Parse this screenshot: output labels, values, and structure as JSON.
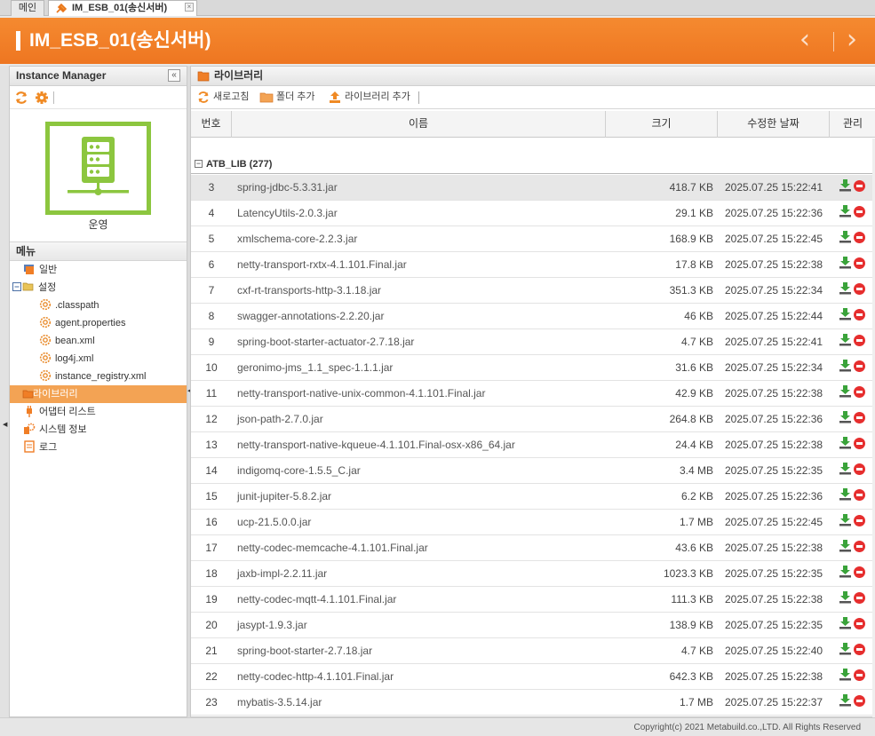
{
  "tabs": [
    {
      "label": "메인",
      "active": false
    },
    {
      "label": "IM_ESB_01(송신서버)",
      "active": true
    }
  ],
  "header": {
    "title": "IM_ESB_01(송신서버)",
    "prev_icon": "chevron-left-icon",
    "next_icon": "chevron-right-icon",
    "color": "#f07e26"
  },
  "left_panel": {
    "title": "Instance Manager",
    "server_label": "운영",
    "server_color": "#8cc63f",
    "menu_title": "메뉴",
    "tree": [
      {
        "label": "일반",
        "icon": "monitor-icon"
      },
      {
        "label": "설정",
        "icon": "folder-open-icon"
      },
      {
        "label": ".classpath",
        "icon": "gear-icon"
      },
      {
        "label": "agent.properties",
        "icon": "gear-icon"
      },
      {
        "label": "bean.xml",
        "icon": "gear-icon"
      },
      {
        "label": "log4j.xml",
        "icon": "gear-icon"
      },
      {
        "label": "instance_registry.xml",
        "icon": "gear-icon"
      },
      {
        "label": "라이브러리",
        "icon": "folder-icon",
        "selected": true
      },
      {
        "label": "어댑터 리스트",
        "icon": "plug-icon"
      },
      {
        "label": "시스템 정보",
        "icon": "system-info-icon"
      },
      {
        "label": "로그",
        "icon": "log-icon"
      }
    ]
  },
  "right_panel": {
    "title": "라이브러리",
    "toolbar": {
      "refresh": "새로고침",
      "add_folder": "폴더 추가",
      "add_library": "라이브러리 추가"
    },
    "columns": {
      "no": "번호",
      "name": "이름",
      "size": "크기",
      "date": "수정한 날짜",
      "manage": "관리"
    },
    "group": "ATB_LIB (277)",
    "rows": [
      {
        "no": "3",
        "name": "spring-jdbc-5.3.31.jar",
        "size": "418.7 KB",
        "date": "2025.07.25 15:22:41"
      },
      {
        "no": "4",
        "name": "LatencyUtils-2.0.3.jar",
        "size": "29.1 KB",
        "date": "2025.07.25 15:22:36"
      },
      {
        "no": "5",
        "name": "xmlschema-core-2.2.3.jar",
        "size": "168.9 KB",
        "date": "2025.07.25 15:22:45"
      },
      {
        "no": "6",
        "name": "netty-transport-rxtx-4.1.101.Final.jar",
        "size": "17.8 KB",
        "date": "2025.07.25 15:22:38"
      },
      {
        "no": "7",
        "name": "cxf-rt-transports-http-3.1.18.jar",
        "size": "351.3 KB",
        "date": "2025.07.25 15:22:34"
      },
      {
        "no": "8",
        "name": "swagger-annotations-2.2.20.jar",
        "size": "46 KB",
        "date": "2025.07.25 15:22:44"
      },
      {
        "no": "9",
        "name": "spring-boot-starter-actuator-2.7.18.jar",
        "size": "4.7 KB",
        "date": "2025.07.25 15:22:41"
      },
      {
        "no": "10",
        "name": "geronimo-jms_1.1_spec-1.1.1.jar",
        "size": "31.6 KB",
        "date": "2025.07.25 15:22:34"
      },
      {
        "no": "11",
        "name": "netty-transport-native-unix-common-4.1.101.Final.jar",
        "size": "42.9 KB",
        "date": "2025.07.25 15:22:38"
      },
      {
        "no": "12",
        "name": "json-path-2.7.0.jar",
        "size": "264.8 KB",
        "date": "2025.07.25 15:22:36"
      },
      {
        "no": "13",
        "name": "netty-transport-native-kqueue-4.1.101.Final-osx-x86_64.jar",
        "size": "24.4 KB",
        "date": "2025.07.25 15:22:38"
      },
      {
        "no": "14",
        "name": "indigomq-core-1.5.5_C.jar",
        "size": "3.4 MB",
        "date": "2025.07.25 15:22:35"
      },
      {
        "no": "15",
        "name": "junit-jupiter-5.8.2.jar",
        "size": "6.2 KB",
        "date": "2025.07.25 15:22:36"
      },
      {
        "no": "16",
        "name": "ucp-21.5.0.0.jar",
        "size": "1.7 MB",
        "date": "2025.07.25 15:22:45"
      },
      {
        "no": "17",
        "name": "netty-codec-memcache-4.1.101.Final.jar",
        "size": "43.6 KB",
        "date": "2025.07.25 15:22:38"
      },
      {
        "no": "18",
        "name": "jaxb-impl-2.2.11.jar",
        "size": "1023.3 KB",
        "date": "2025.07.25 15:22:35"
      },
      {
        "no": "19",
        "name": "netty-codec-mqtt-4.1.101.Final.jar",
        "size": "111.3 KB",
        "date": "2025.07.25 15:22:38"
      },
      {
        "no": "20",
        "name": "jasypt-1.9.3.jar",
        "size": "138.9 KB",
        "date": "2025.07.25 15:22:35"
      },
      {
        "no": "21",
        "name": "spring-boot-starter-2.7.18.jar",
        "size": "4.7 KB",
        "date": "2025.07.25 15:22:40"
      },
      {
        "no": "22",
        "name": "netty-codec-http-4.1.101.Final.jar",
        "size": "642.3 KB",
        "date": "2025.07.25 15:22:38"
      },
      {
        "no": "23",
        "name": "mybatis-3.5.14.jar",
        "size": "1.7 MB",
        "date": "2025.07.25 15:22:37"
      }
    ]
  },
  "footer": {
    "copyright": "Copyright(c) 2021 Metabuild.co.,LTD. All Rights Reserved"
  }
}
